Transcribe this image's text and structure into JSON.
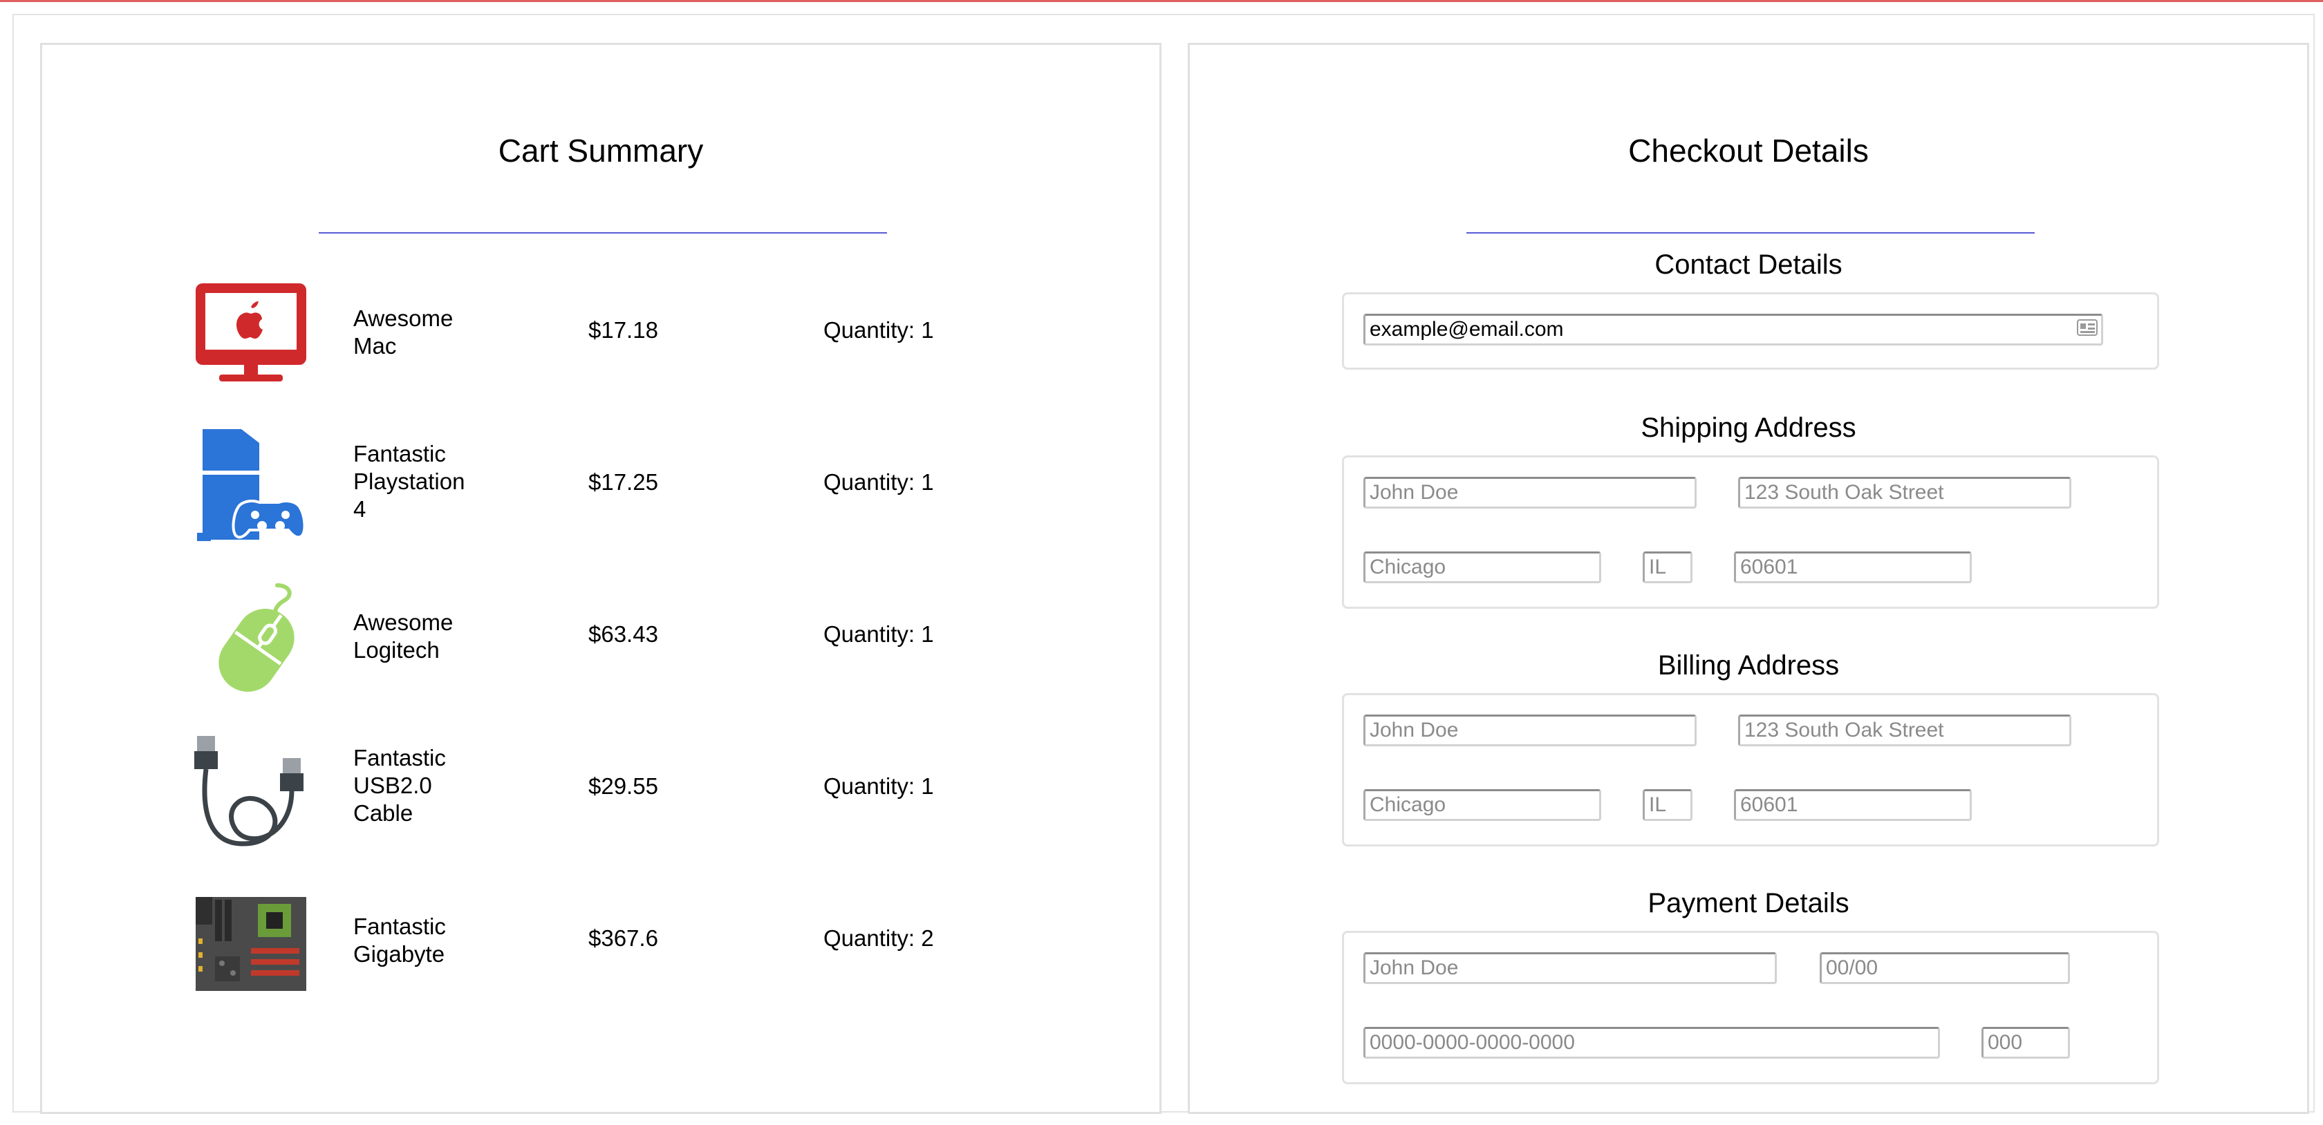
{
  "cart": {
    "title": "Cart Summary",
    "items": [
      {
        "name_lines": [
          "Awesome",
          "Mac"
        ],
        "price": "$17.18",
        "quantity": "Quantity: 1",
        "icon": "imac-icon"
      },
      {
        "name_lines": [
          "Fantastic",
          "Playstation",
          "4"
        ],
        "price": "$17.25",
        "quantity": "Quantity: 1",
        "icon": "playstation-icon"
      },
      {
        "name_lines": [
          "Awesome",
          "Logitech"
        ],
        "price": "$63.43",
        "quantity": "Quantity: 1",
        "icon": "mouse-icon"
      },
      {
        "name_lines": [
          "Fantastic",
          "USB2.0",
          "Cable"
        ],
        "price": "$29.55",
        "quantity": "Quantity: 1",
        "icon": "usb-cable-icon"
      },
      {
        "name_lines": [
          "Fantastic",
          "Gigabyte"
        ],
        "price": "$367.6",
        "quantity": "Quantity: 2",
        "icon": "motherboard-icon"
      }
    ]
  },
  "checkout": {
    "title": "Checkout Details",
    "contact": {
      "title": "Contact Details",
      "email_value": "example@email.com"
    },
    "shipping": {
      "title": "Shipping Address",
      "name_placeholder": "John Doe",
      "street_placeholder": "123 South Oak Street",
      "city_placeholder": "Chicago",
      "state_placeholder": "IL",
      "zip_placeholder": "60601"
    },
    "billing": {
      "title": "Billing Address",
      "name_placeholder": "John Doe",
      "street_placeholder": "123 South Oak Street",
      "city_placeholder": "Chicago",
      "state_placeholder": "IL",
      "zip_placeholder": "60601"
    },
    "payment": {
      "title": "Payment Details",
      "name_placeholder": "John Doe",
      "expiry_placeholder": "00/00",
      "card_placeholder": "0000-0000-0000-0000",
      "cvv_placeholder": "000"
    }
  },
  "colors": {
    "underline": "#5b5bd6",
    "mac_red": "#d0292c",
    "ps_blue": "#2b74d8",
    "mouse_green": "#a3d96b",
    "cable_dark": "#3b4248",
    "board_dark": "#4a4a4a"
  }
}
